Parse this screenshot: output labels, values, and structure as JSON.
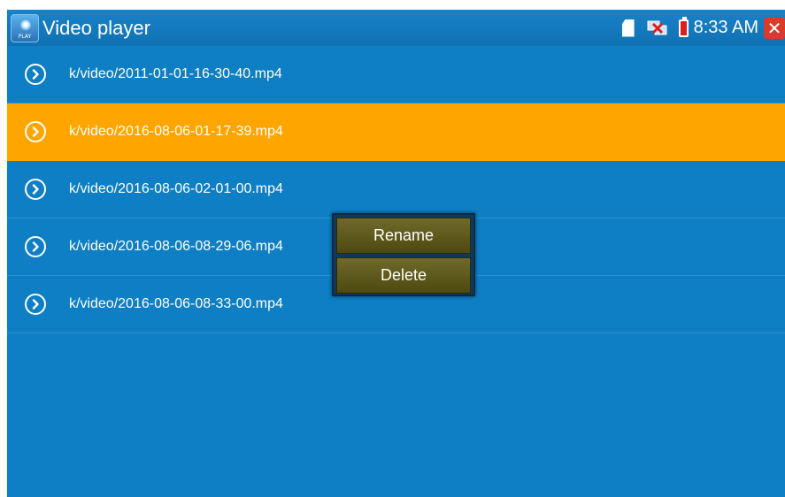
{
  "header": {
    "title": "Video player",
    "app_icon_text": "PLAY",
    "time": "8:33 AM",
    "close_glyph": "✕"
  },
  "files": [
    {
      "name": "k/video/2011-01-01-16-30-40.mp4",
      "selected": false
    },
    {
      "name": "k/video/2016-08-06-01-17-39.mp4",
      "selected": true
    },
    {
      "name": "k/video/2016-08-06-02-01-00.mp4",
      "selected": false
    },
    {
      "name": "k/video/2016-08-06-08-29-06.mp4",
      "selected": false
    },
    {
      "name": "k/video/2016-08-06-08-33-00.mp4",
      "selected": false
    }
  ],
  "context_menu": {
    "rename_label": "Rename",
    "delete_label": "Delete"
  },
  "icons": {
    "app": "video-play-icon",
    "sd_card": "sd-card-icon",
    "network": "network-disconnected-icon",
    "battery": "battery-charging-icon",
    "close": "close-icon",
    "row_play": "play-circle-icon"
  },
  "colors": {
    "background": "#0e7fc4",
    "selected_row": "#ffa500",
    "menu_button": "#5e5a1c",
    "close_button": "#d93a2b"
  }
}
